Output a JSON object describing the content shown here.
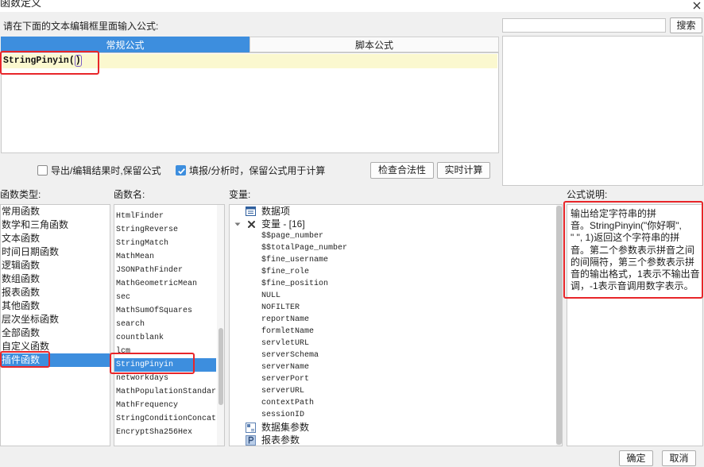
{
  "window": {
    "title": "函数定义"
  },
  "icons": {
    "close": "close-icon",
    "checkbox": "check-icon",
    "tree_toggle": "chevron-down-icon",
    "data_items": "table-icon",
    "variables": "variable-icon",
    "dataset_params": "dataset-param-icon",
    "report_params": "param-icon"
  },
  "colors": {
    "accent": "#3d8ede",
    "current_line": "#fbf8cf",
    "annotation": "#e8262a"
  },
  "prompt": "请在下面的文本编辑框里面输入公式:",
  "search": {
    "value": "",
    "button_label": "搜索"
  },
  "tabs": [
    {
      "label": "常规公式",
      "selected": true
    },
    {
      "label": "脚本公式",
      "selected": false
    }
  ],
  "editor": {
    "text": "StringPinyin(",
    "matched_bracket": ")"
  },
  "options": [
    {
      "label": "导出/编辑结果时,保留公式",
      "checked": false
    },
    {
      "label": "填报/分析时，保留公式用于计算",
      "checked": true
    }
  ],
  "actions": {
    "check_validity": "检查合法性",
    "realtime_calc": "实时计算"
  },
  "sections": {
    "function_type": "函数类型:",
    "function_name": "函数名:",
    "variables": "变量:",
    "description": "公式说明:"
  },
  "function_types": [
    {
      "label": "常用函数"
    },
    {
      "label": "数学和三角函数"
    },
    {
      "label": "文本函数"
    },
    {
      "label": "时间日期函数"
    },
    {
      "label": "逻辑函数"
    },
    {
      "label": "数组函数"
    },
    {
      "label": "报表函数"
    },
    {
      "label": "其他函数"
    },
    {
      "label": "层次坐标函数"
    },
    {
      "label": "全部函数"
    },
    {
      "label": "自定义函数"
    },
    {
      "label": "插件函数",
      "selected": true
    }
  ],
  "function_names": [
    {
      "name": "HtmlFinder"
    },
    {
      "name": "StringReverse"
    },
    {
      "name": "StringMatch"
    },
    {
      "name": "MathMean"
    },
    {
      "name": "JSONPathFinder"
    },
    {
      "name": "MathGeometricMean"
    },
    {
      "name": "sec"
    },
    {
      "name": "MathSumOfSquares"
    },
    {
      "name": "search"
    },
    {
      "name": "countblank"
    },
    {
      "name": "lcm"
    },
    {
      "name": "StringPinyin",
      "selected": true
    },
    {
      "name": "networkdays"
    },
    {
      "name": "MathPopulationStandar"
    },
    {
      "name": "MathFrequency"
    },
    {
      "name": "StringConditionConcat"
    },
    {
      "name": "EncryptSha256Hex"
    }
  ],
  "variables": {
    "data_items": "数据项",
    "group": {
      "label": "变量 - [16]",
      "expanded": true,
      "items": [
        "$$page_number",
        "$$totalPage_number",
        "$fine_username",
        "$fine_role",
        "$fine_position",
        "NULL",
        "NOFILTER",
        "reportName",
        "formletName",
        "servletURL",
        "serverSchema",
        "serverName",
        "serverPort",
        "serverURL",
        "contextPath",
        "sessionID"
      ]
    },
    "dataset_params": "数据集参数",
    "report_params": "报表参数"
  },
  "description_lines": [
    "输出给定字符串的拼",
    "音。StringPinyin(\"你好啊\",",
    "\" \", 1)返回这个字符串的拼",
    "音。第二个参数表示拼音之间",
    "的间隔符，第三个参数表示拼",
    "音的输出格式，1表示不输出音",
    "调，-1表示音调用数字表示。"
  ],
  "footer": {
    "ok": "确定",
    "cancel": "取消"
  }
}
